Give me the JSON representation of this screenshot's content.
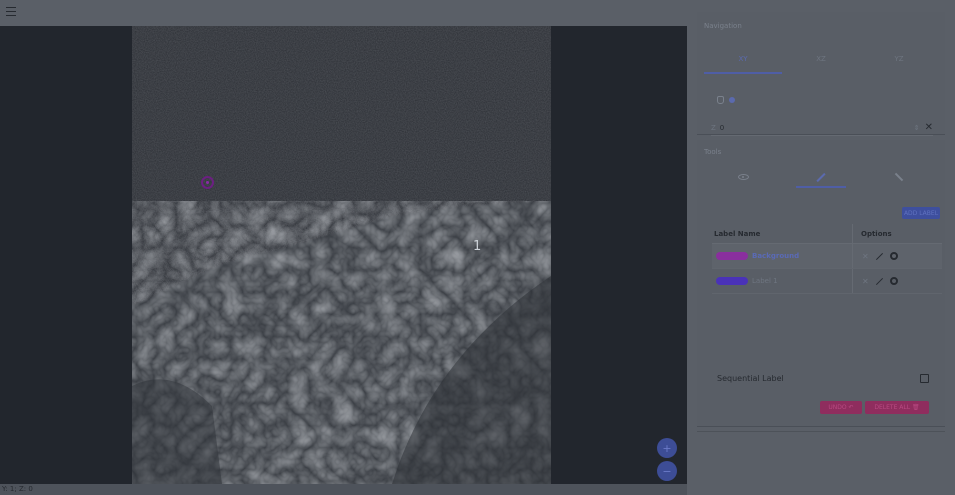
{
  "topbar": {
    "menu_icon": "menu-icon"
  },
  "viewer": {
    "slice_number": "1",
    "status_text": "Y: 1; Z: 0",
    "zoom_in_label": "+",
    "zoom_out_label": "−",
    "fullscreen_label": "⛶"
  },
  "navigation": {
    "title": "Navigation",
    "tabs": [
      {
        "label": "XY",
        "active": true
      },
      {
        "label": "XZ",
        "active": false
      },
      {
        "label": "YZ",
        "active": false
      }
    ],
    "slice_prefix": "Z",
    "slice_value": "0",
    "slice_stepper": "⇕",
    "clear_label": "✕"
  },
  "tools": {
    "title": "Tools",
    "tabs": [
      {
        "icon": "eye-icon",
        "active": false
      },
      {
        "icon": "pencil-icon",
        "active": true
      },
      {
        "icon": "wand-icon",
        "active": false
      }
    ],
    "add_label_button": "ADD LABEL",
    "table_headers": {
      "name": "Label Name",
      "options": "Options"
    },
    "labels": [
      {
        "name": "Background",
        "color": "#8a2f9e",
        "selected": true
      },
      {
        "name": "Label 1",
        "color": "#4a32b8",
        "selected": false
      }
    ],
    "option_close": "✕",
    "sequential_label": "Sequential Label",
    "undo_button": "UNDO ↶",
    "delete_all_button": "DELETE ALL 🗑"
  },
  "colors": {
    "accent": "#4f5ea6",
    "danger": "#8f2d5e",
    "panel": "#5a5f67",
    "viewer_bg": "#22262d"
  }
}
